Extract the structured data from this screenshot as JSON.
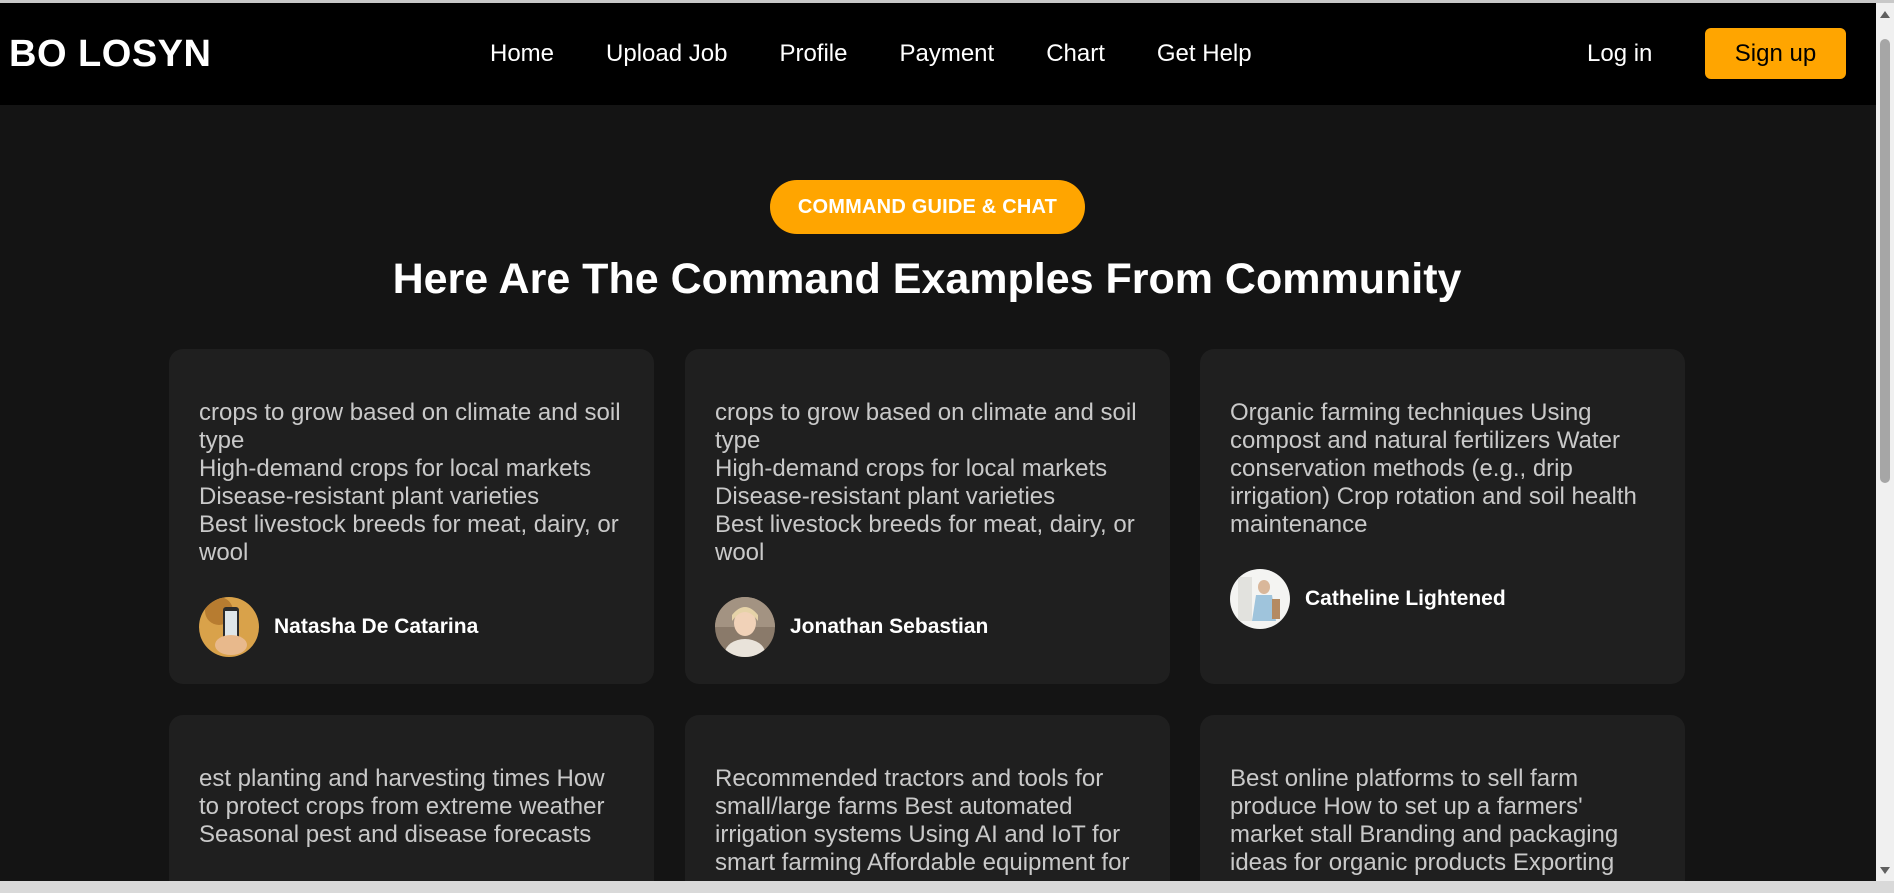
{
  "brand": {
    "logo": "BO LOSYN"
  },
  "nav": {
    "links": [
      "Home",
      "Upload Job",
      "Profile",
      "Payment",
      "Chart",
      "Get Help"
    ],
    "login": "Log in",
    "signup": "Sign up"
  },
  "hero": {
    "badge": "COMMAND GUIDE & CHAT",
    "title": "Here Are The Command Examples From Community"
  },
  "cards": [
    {
      "text": "crops to grow based on climate and soil type\nHigh-demand crops for local markets\nDisease-resistant plant varieties\nBest livestock breeds for meat, dairy, or wool",
      "author": "Natasha De Catarina"
    },
    {
      "text": "crops to grow based on climate and soil type\nHigh-demand crops for local markets\nDisease-resistant plant varieties\nBest livestock breeds for meat, dairy, or wool",
      "author": "Jonathan Sebastian"
    },
    {
      "text": "Organic farming techniques Using compost and natural fertilizers Water conservation methods (e.g., drip irrigation) Crop rotation and soil health maintenance",
      "author": "Catheline Lightened"
    },
    {
      "text": "est planting and harvesting times How to protect crops from extreme weather Seasonal pest and disease forecasts"
    },
    {
      "text": "Recommended tractors and tools for small/large farms Best automated irrigation systems Using AI and IoT for smart farming Affordable equipment for"
    },
    {
      "text": "Best online platforms to sell farm produce How to set up a farmers' market stall Branding and packaging ideas for organic products Exporting"
    }
  ],
  "colors": {
    "accent": "#ffa500",
    "background": "#141414",
    "card": "#1f1f1f",
    "navbar": "#000000"
  }
}
